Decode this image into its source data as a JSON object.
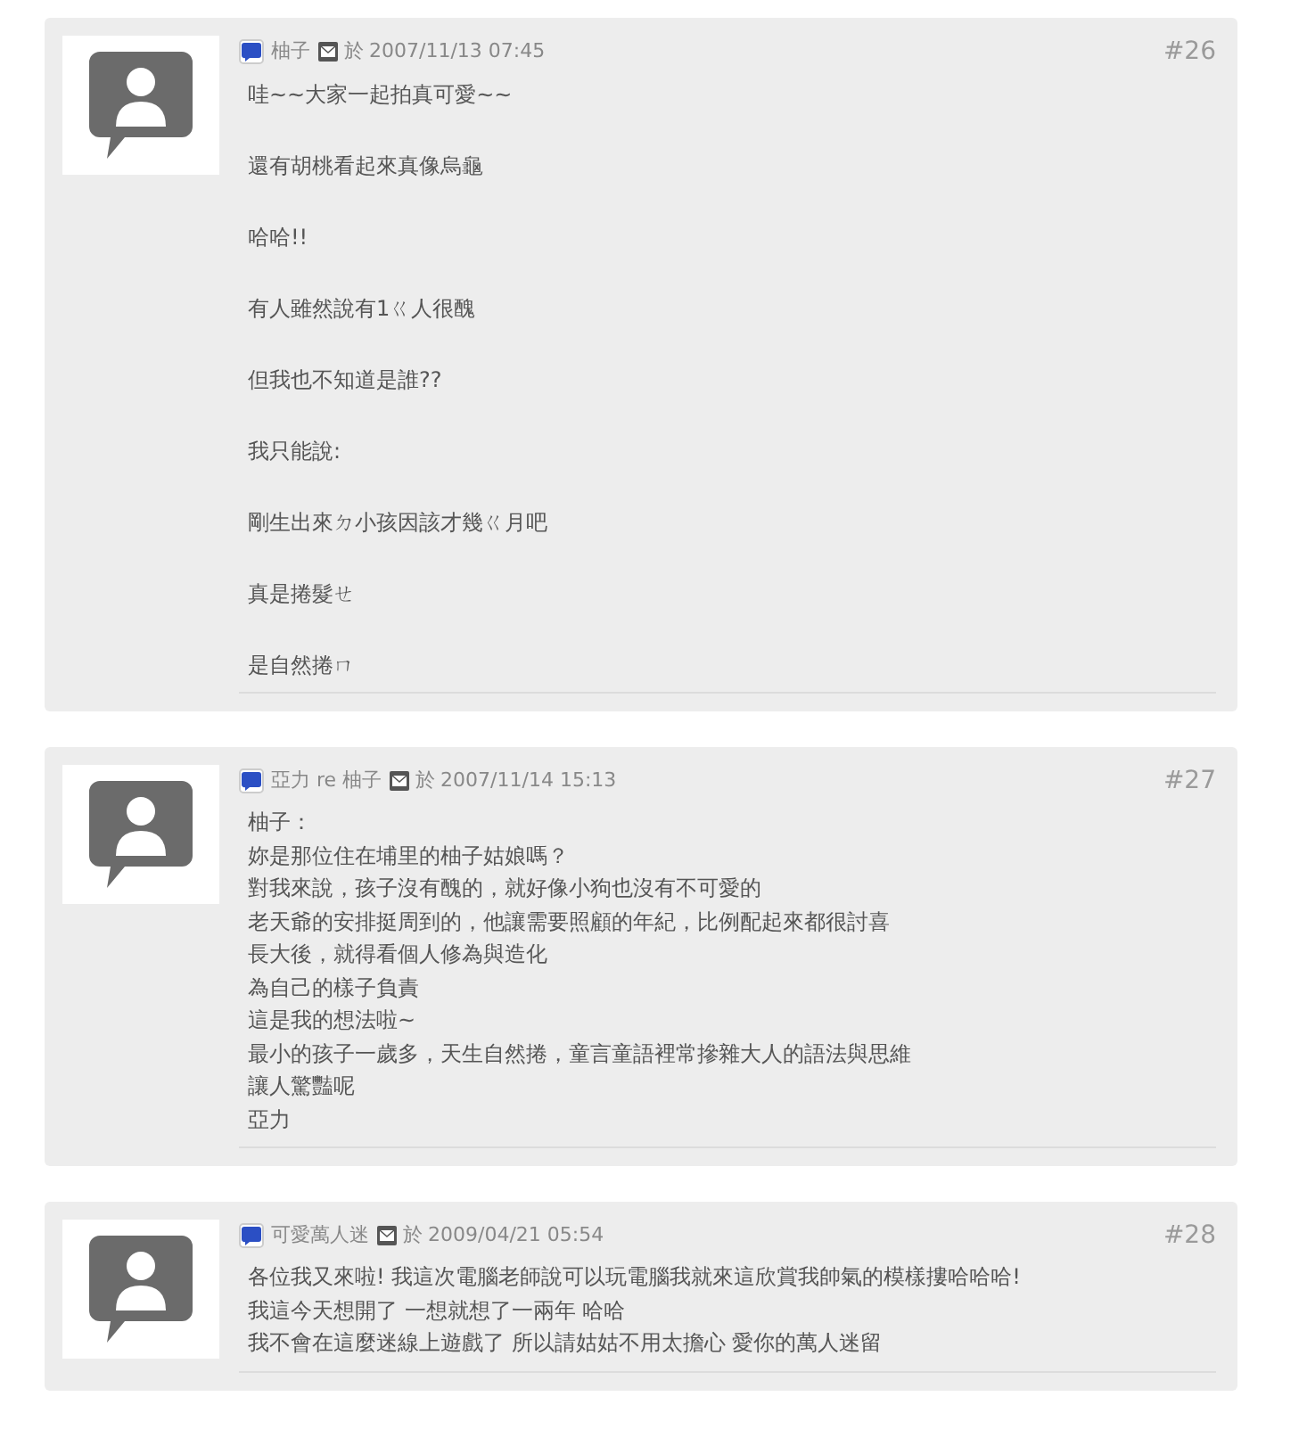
{
  "posts": [
    {
      "author": "柚子",
      "on": "於",
      "date": "2007/11/13 07:45",
      "number": "#26",
      "kind": "paragraphs",
      "lines": [
        "哇~~大家一起拍真可愛~~",
        "還有胡桃看起來真像烏龜",
        "哈哈!!",
        "有人雖然說有1ㄍ人很醜",
        "但我也不知道是誰??",
        "我只能說:",
        "剛生出來ㄉ小孩因該才幾ㄍ月吧",
        "真是捲髮ㄝ",
        "是自然捲ㄇ"
      ]
    },
    {
      "author": "亞力 re 柚子",
      "on": "於",
      "date": "2007/11/14 15:13",
      "number": "#27",
      "kind": "lines",
      "lines": [
        "柚子：",
        "妳是那位住在埔里的柚子姑娘嗎？",
        "對我來說，孩子沒有醜的，就好像小狗也沒有不可愛的",
        "老天爺的安排挺周到的，他讓需要照顧的年紀，比例配起來都很討喜",
        "長大後，就得看個人修為與造化",
        "為自己的樣子負責",
        "這是我的想法啦~",
        "最小的孩子一歲多，天生自然捲，童言童語裡常摻雜大人的語法與思維",
        "讓人驚豔呢",
        "亞力"
      ]
    },
    {
      "author": "可愛萬人迷",
      "on": "於",
      "date": "2009/04/21 05:54",
      "number": "#28",
      "kind": "lines",
      "lines": [
        "各位我又來啦! 我這次電腦老師說可以玩電腦我就來這欣賞我帥氣的模樣摟哈哈哈!",
        "我這今天想開了 一想就想了一兩年 哈哈",
        "我不會在這麼迷線上遊戲了 所以請姑姑不用太擔心 愛你的萬人迷留"
      ]
    }
  ]
}
